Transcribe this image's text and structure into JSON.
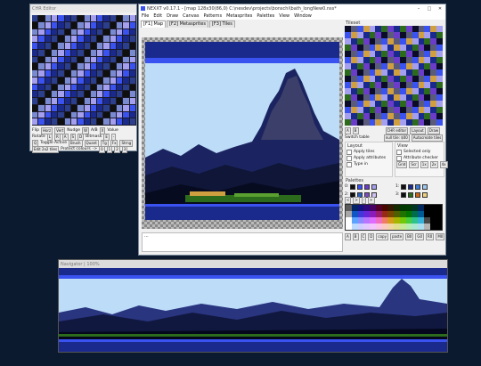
{
  "chr_editor": {
    "title": "CHR Editor",
    "flip_label": "Flip",
    "horz": "Horz",
    "vert": "Vert",
    "nudge": "Nudge",
    "nudge_w": "W",
    "ab": "A/B",
    "x": "X",
    "value": "Value",
    "rotate": "Rotate",
    "rot_l": "L",
    "rot_r": "R",
    "nudge_a": "A",
    "nudge_s": "S",
    "nudge_d": "D",
    "bitmask": "Bitmask",
    "bm_e": "E",
    "bm_minus": "-",
    "q": "Q",
    "toggle_active": "Toggle Active",
    "brush": "Brush",
    "quant": "Quant",
    "tg": "Tg",
    "fx": "Fx",
    "strng": "Strng",
    "edit_2x2": "Edit 2x2 tiles",
    "protect_colours": "Protect colours",
    "pc_arrow": "->",
    "pc_0": "0",
    "pc_1": "1",
    "pc_2": "2",
    "pc_3": "3"
  },
  "main": {
    "title": "NEXXT v0.17.1 - [map 128x30(86,0) C:\\nesdev\\projects\\bonschi\\bath_longNew0.nss*",
    "menu": [
      "File",
      "Edit",
      "Draw",
      "Canvas",
      "Patterns",
      "Metasprites",
      "Palettes",
      "View",
      "Window"
    ],
    "tabs": [
      "[F1] Map",
      "[F2] Metasprites",
      "[F3] Tiles"
    ],
    "status": "..."
  },
  "tileset": {
    "title": "Tileset",
    "a": "A",
    "b": "B",
    "switch_table": "Switch table",
    "chr_editor": "CHR editor",
    "null_tile": "null tile: $00",
    "layout": "Layout",
    "draw": "Draw",
    "autocreate": "Autocreate tiles"
  },
  "layout_panel": {
    "title": "Layout",
    "apply_tiles": "Apply tiles",
    "apply_attributes": "Apply attributes",
    "type_in": "Type in",
    "grid": "Grid",
    "scr": "Scr",
    "view_title": "View",
    "selected_only": "Selected only",
    "attribute_checker": "Attribute checker",
    "z1": "1x",
    "z2": "2x",
    "z4": "4x"
  },
  "palettes": {
    "title": "Palettes",
    "labels": [
      "0:",
      "1:",
      "2:",
      "3:"
    ],
    "sets": [
      [
        "#0f0f10",
        "#3a52f0",
        "#6a3cc9",
        "#a59ff0"
      ],
      [
        "#0f0f10",
        "#1a2a8c",
        "#3c7cd8",
        "#9ec8f0"
      ],
      [
        "#0f0f10",
        "#2b5fb8",
        "#7c4cc0",
        "#d0c0f0"
      ],
      [
        "#0f0f10",
        "#2d6b1c",
        "#c86418",
        "#f0d078"
      ]
    ],
    "tabs": [
      "A",
      "B",
      "C",
      "D"
    ],
    "copy": "copy",
    "paste": "paste",
    "modes": [
      "B0",
      "G0",
      "R0",
      "M0"
    ],
    "nav": [
      "<",
      ">",
      "-",
      "+"
    ]
  },
  "navigator": {
    "title": "Navigator | 100%"
  },
  "colors": {
    "desktop": "#0b1a2e",
    "sky": "#bcdcf8",
    "accent": "#3a52f0"
  }
}
